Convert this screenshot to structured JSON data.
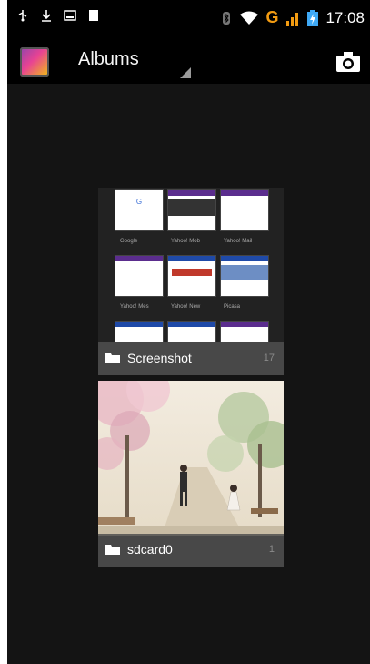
{
  "status_bar": {
    "time": "17:08",
    "network_label": "G",
    "icons": [
      "usb-icon",
      "download-icon",
      "image-icon",
      "sd-icon",
      "bluetooth-icon",
      "wifi-icon",
      "signal-icon",
      "battery-icon"
    ]
  },
  "action_bar": {
    "title": "Albums",
    "icons": [
      "gallery-app-icon",
      "camera-icon"
    ]
  },
  "albums": [
    {
      "name": "Screenshot",
      "count": "17",
      "thumb_captions": [
        "Google",
        "Yahoo! Mob",
        "Yahoo! Mail",
        "Yahoo! Mes",
        "Yahoo! New",
        "Picasa"
      ]
    },
    {
      "name": "sdcard0",
      "count": "1"
    }
  ],
  "colors": {
    "background": "#141414",
    "status_bar": "#000000",
    "network_accent": "#f39c12",
    "label_overlay": "#505050"
  }
}
